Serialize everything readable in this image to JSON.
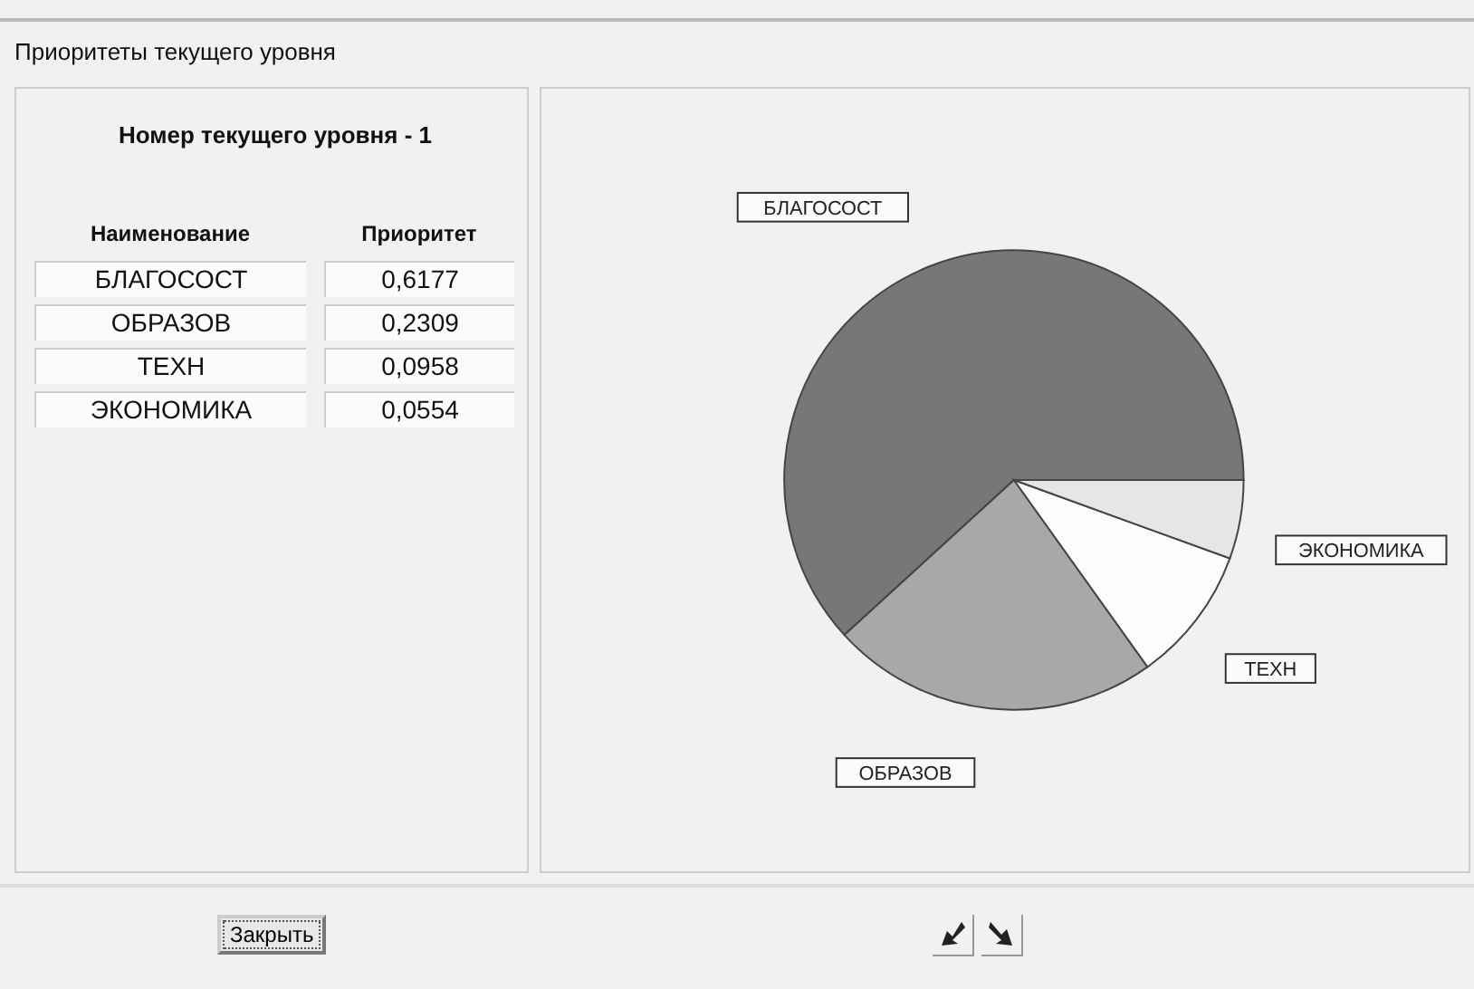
{
  "window": {
    "title": "Приоритеты текущего уровня"
  },
  "left_panel": {
    "heading": "Номер текущего уровня - 1",
    "columns": [
      "Наименование",
      "Приоритет"
    ],
    "rows": [
      {
        "name": "БЛАГОСОСТ",
        "priority": "0,6177"
      },
      {
        "name": "ОБРАЗОВ",
        "priority": "0,2309"
      },
      {
        "name": "ТЕХН",
        "priority": "0,0958"
      },
      {
        "name": "ЭКОНОМИКА",
        "priority": "0,0554"
      }
    ]
  },
  "chart": {
    "chart_data": {
      "type": "pie",
      "categories": [
        "БЛАГОСОСТ",
        "ОБРАЗОВ",
        "ТЕХН",
        "ЭКОНОМИКА"
      ],
      "values": [
        0.6177,
        0.2309,
        0.0958,
        0.0554
      ]
    }
  },
  "footer": {
    "close_button": "Закрыть"
  }
}
